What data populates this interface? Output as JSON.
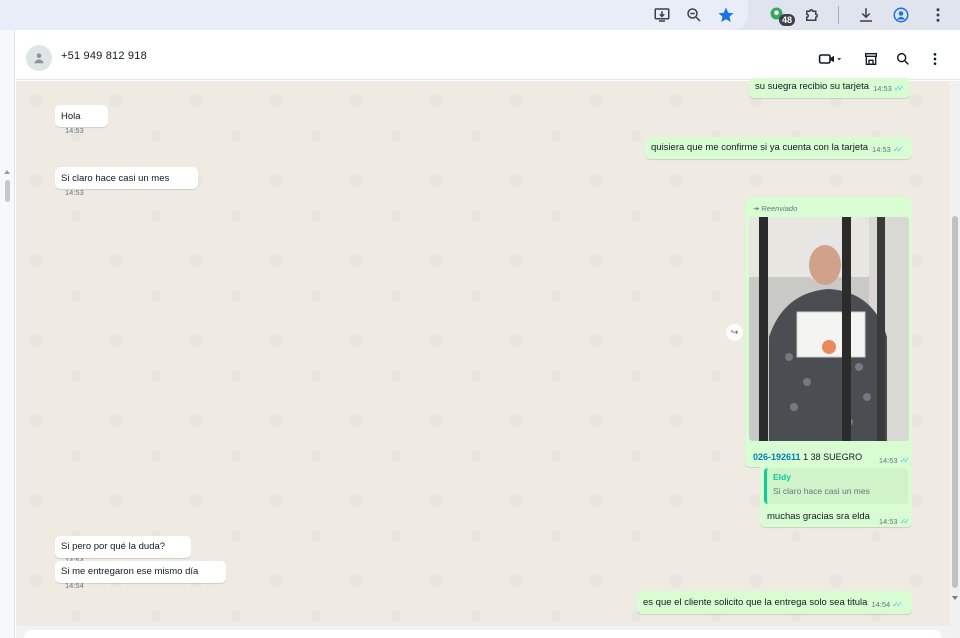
{
  "browser": {
    "extensions_badge": "48"
  },
  "chat": {
    "contact_name": "+51 949 812 918"
  },
  "messages": [
    {
      "dir": "out",
      "text": "su suegra recibio su tarjeta",
      "time": "14:53"
    },
    {
      "dir": "in",
      "text": "Hola",
      "time": "14:53"
    },
    {
      "dir": "out",
      "text": "quisiera que me confirme si ya cuenta con la tarjeta",
      "time": "14:53"
    },
    {
      "dir": "in",
      "text": "Si claro hace casi un mes",
      "time": "14:53"
    },
    {
      "dir": "out",
      "forwarded_label": "Reenviado",
      "caption_bold": "026-192611",
      "caption_rest": " 1 38 SUEGRO",
      "time": "14:53"
    },
    {
      "dir": "out",
      "quote_author": "Eldy",
      "quote_text": "Si claro hace casi un mes",
      "text": "muchas gracias sra elda",
      "time": "14:53"
    },
    {
      "dir": "in",
      "text": "Si pero por qué la duda?",
      "time": "14:54"
    },
    {
      "dir": "in",
      "text": "Si me entregaron ese mismo día",
      "time": "14:54"
    },
    {
      "dir": "out",
      "text": "es que el cliente solicito que la entrega solo sea titula",
      "time": "14:54"
    }
  ],
  "icons": {
    "install": "install-app-icon",
    "zoom": "zoom-out-icon",
    "bookmark": "bookmark-star-icon",
    "extensions_app": "extension-app-icon",
    "puzzle": "extensions-puzzle-icon",
    "download": "download-icon",
    "profile": "profile-icon",
    "menu": "kebab-menu-icon",
    "video": "video-call-icon",
    "store": "catalog-store-icon",
    "search": "search-icon"
  },
  "colors": {
    "incoming_bubble": "#ffffff",
    "outgoing_bubble": "#d9fdd3",
    "chat_background": "#efeae2",
    "read_ticks": "#53bdeb",
    "quote_accent": "#06cf9c",
    "bookmark_star": "#1a73e8"
  }
}
